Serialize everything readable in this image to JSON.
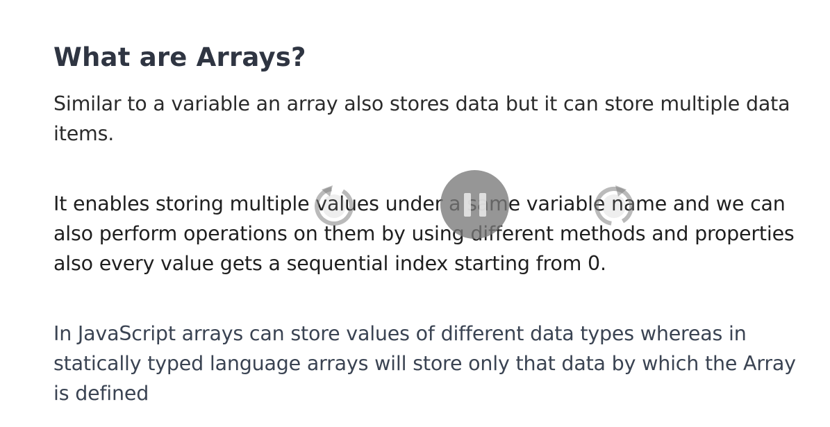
{
  "slide": {
    "title": "What are Arrays?",
    "paragraphs": [
      "Similar to a variable an array also stores data but it can store multiple data items.",
      "It enables storing multiple values under a same variable name and we can also perform operations on them by using different methods and properties also every value gets a sequential index starting from 0.",
      "In JavaScript arrays can store values of different data types whereas in statically typed language arrays will store only that data by which the Array is defined"
    ]
  },
  "player": {
    "rewind_icon": "rewind-icon",
    "pause_icon": "pause-icon",
    "forward_icon": "forward-icon",
    "overlay_color": "#787878"
  }
}
